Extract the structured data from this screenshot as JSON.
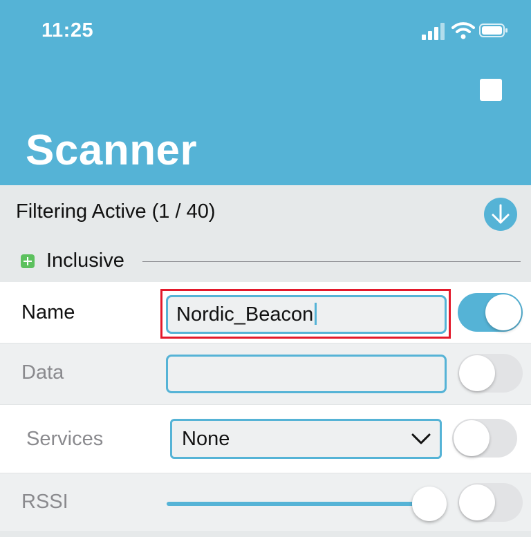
{
  "status_bar": {
    "time": "11:25",
    "icons": [
      "cellular-signal-icon",
      "wifi-icon",
      "battery-icon"
    ]
  },
  "header": {
    "title": "Scanner",
    "stop_icon": "stop-icon"
  },
  "filter": {
    "status": "Filtering Active (1 / 40)",
    "collapse_icon": "arrow-down-circle-icon",
    "mode_label": "Inclusive"
  },
  "rows": {
    "name": {
      "label": "Name",
      "value": "Nordic_Beacon",
      "enabled": true
    },
    "data": {
      "label": "Data",
      "value": "",
      "enabled": false
    },
    "services": {
      "label": "Services",
      "selected": "None",
      "enabled": false
    },
    "rssi": {
      "label": "RSSI",
      "slider_fraction": 0.95,
      "enabled": false
    }
  },
  "colors": {
    "accent": "#55b3d6",
    "highlight": "#e3192b",
    "inclusive_badge": "#5cc15e"
  }
}
